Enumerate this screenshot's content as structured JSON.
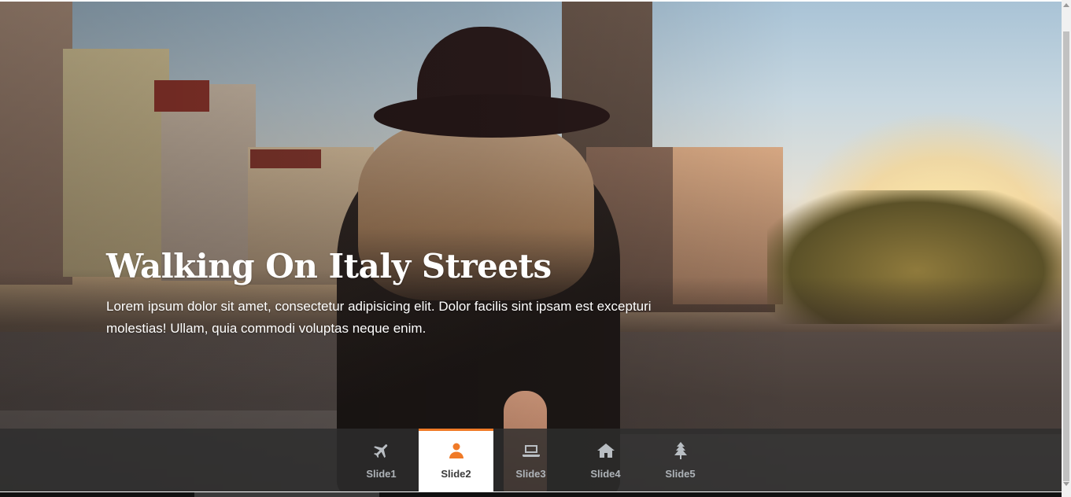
{
  "hero": {
    "title": "Walking On Italy Streets",
    "description": "Lorem ipsum dolor sit amet, consectetur adipisicing elit. Dolor facilis sint ipsam est excepturi molestias! Ullam, quia commodi voluptas neque enim."
  },
  "nav": {
    "active_index": 1,
    "accent_color": "#f07a27",
    "tabs": [
      {
        "label": "Slide1",
        "icon": "plane-icon"
      },
      {
        "label": "Slide2",
        "icon": "user-icon"
      },
      {
        "label": "Slide3",
        "icon": "laptop-icon"
      },
      {
        "label": "Slide4",
        "icon": "home-icon"
      },
      {
        "label": "Slide5",
        "icon": "tree-icon"
      }
    ]
  }
}
